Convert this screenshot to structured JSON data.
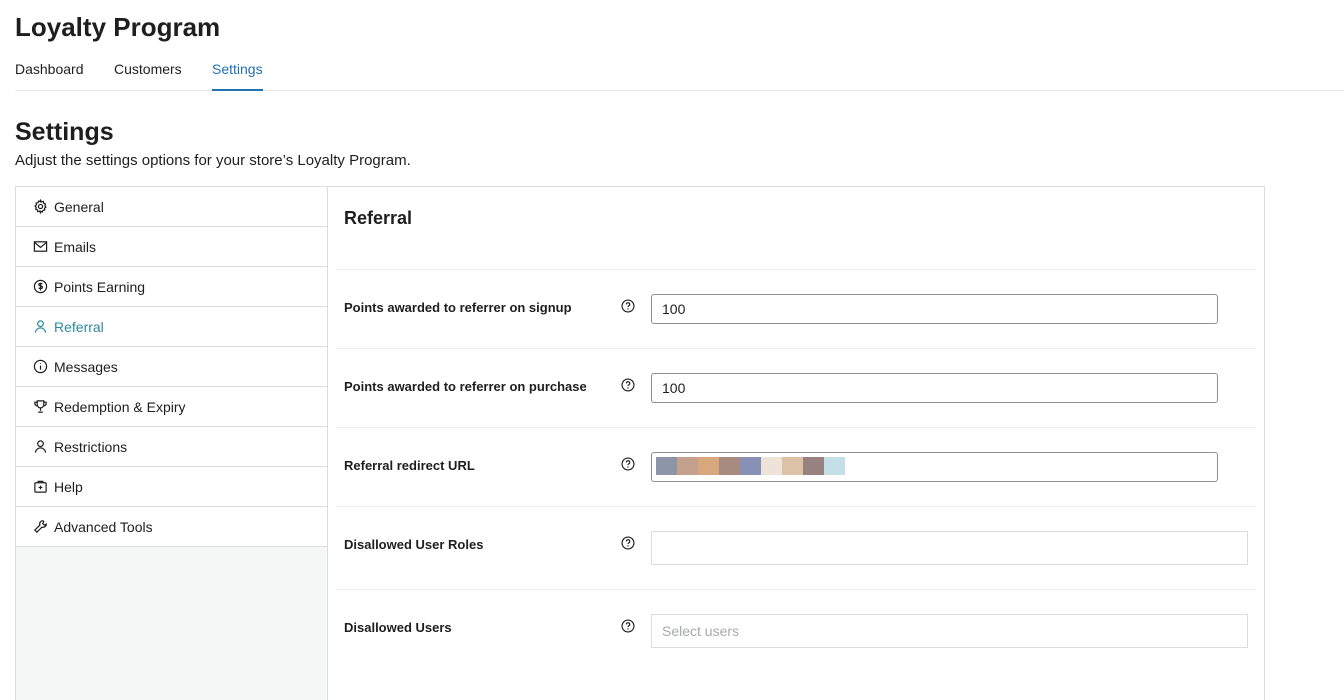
{
  "app": {
    "title": "Loyalty Program"
  },
  "tabs": [
    {
      "label": "Dashboard"
    },
    {
      "label": "Customers"
    },
    {
      "label": "Settings"
    }
  ],
  "page": {
    "title": "Settings",
    "description": "Adjust the settings options for your store’s Loyalty Program."
  },
  "sidebar": {
    "items": [
      {
        "label": "General",
        "icon": "gear-icon"
      },
      {
        "label": "Emails",
        "icon": "envelope-icon"
      },
      {
        "label": "Points Earning",
        "icon": "dollar-coin-icon"
      },
      {
        "label": "Referral",
        "icon": "user-icon"
      },
      {
        "label": "Messages",
        "icon": "info-icon"
      },
      {
        "label": "Redemption & Expiry",
        "icon": "trophy-icon"
      },
      {
        "label": "Restrictions",
        "icon": "user-icon"
      },
      {
        "label": "Help",
        "icon": "help-box-icon"
      },
      {
        "label": "Advanced Tools",
        "icon": "wrench-icon"
      }
    ],
    "active": "Referral"
  },
  "section": {
    "title": "Referral",
    "rows": [
      {
        "label": "Points awarded to referrer on signup",
        "value": "100"
      },
      {
        "label": "Points awarded to referrer on purchase",
        "value": "100"
      },
      {
        "label": "Referral redirect URL",
        "value": ""
      },
      {
        "label": "Disallowed User Roles",
        "value": ""
      },
      {
        "label": "Disallowed Users",
        "value": "",
        "placeholder": "Select users"
      }
    ]
  },
  "colors": {
    "accent": "#2271b1",
    "active_sidebar": "#2e8a9e",
    "redacted_swatches": [
      "#8b95a5",
      "#c4a08e",
      "#d8a87c",
      "#a78b80",
      "#8891b5",
      "#ede3d8",
      "#dcc2a7",
      "#978282",
      "#c5dfe9"
    ]
  }
}
